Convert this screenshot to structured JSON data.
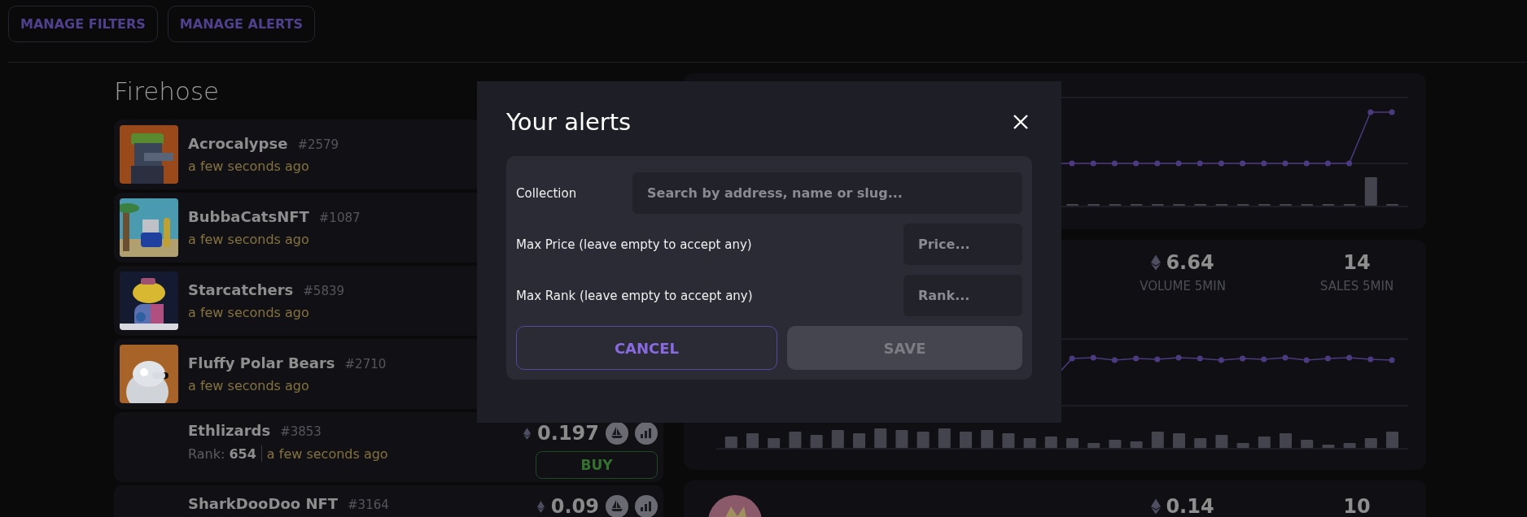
{
  "toolbar": [
    {
      "label": "MANAGE FILTERS"
    },
    {
      "label": "MANAGE ALERTS"
    }
  ],
  "firehose": {
    "title": "Firehose",
    "items": [
      {
        "kind": "avatar",
        "name": "Acrocalypse",
        "token": "#2579",
        "time": "a few seconds ago"
      },
      {
        "kind": "avatar",
        "name": "BubbaCatsNFT",
        "token": "#1087",
        "time": "a few seconds ago"
      },
      {
        "kind": "avatar",
        "name": "Starcatchers",
        "token": "#5839",
        "time": "a few seconds ago"
      },
      {
        "kind": "avatar",
        "name": "Fluffy Polar Bears",
        "token": "#2710",
        "time": "a few seconds ago"
      },
      {
        "kind": "listing",
        "name": "Ethlizards",
        "token": "#3853",
        "rank_label": "Rank:",
        "rank": "654",
        "time": "a few seconds ago",
        "price": "0.197",
        "action": "BUY"
      },
      {
        "kind": "listing",
        "name": "SharkDooDoo NFT",
        "token": "#3164",
        "price": "0.09"
      }
    ]
  },
  "collections": [
    {
      "kind": "chart"
    },
    {
      "kind": "stats",
      "stats": [
        {
          "value": "6.64",
          "eth_icon": true,
          "label": "VOLUME 5MIN"
        },
        {
          "value": "14",
          "label": "SALES 5MIN"
        }
      ]
    },
    {
      "kind": "partial",
      "stats": [
        {
          "value": "0.14",
          "eth_icon": true
        },
        {
          "value": "10"
        }
      ]
    }
  ],
  "modal": {
    "title": "Your alerts",
    "fields": [
      {
        "kind": "wide",
        "label": "Collection",
        "placeholder": "Search by address, name or slug..."
      },
      {
        "kind": "narrow",
        "label": "Max Price (leave empty to accept any)",
        "placeholder": "Price..."
      },
      {
        "kind": "narrow",
        "label": "Max Rank (leave empty to accept any)",
        "placeholder": "Rank..."
      }
    ],
    "buttons": [
      {
        "kind": "outline",
        "label": "CANCEL",
        "disabled": false
      },
      {
        "kind": "filled",
        "label": "SAVE",
        "disabled": true
      }
    ]
  }
}
